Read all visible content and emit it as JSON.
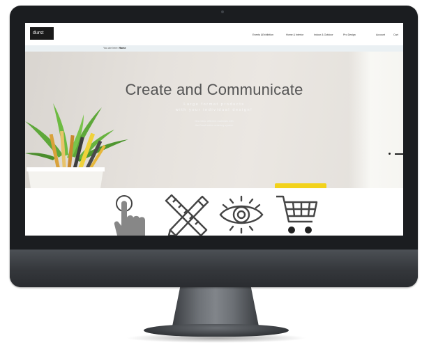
{
  "header": {
    "logo_text": "durst",
    "nav": [
      "Events &Exhibition",
      "Home & Interior",
      "Indoor & Outdoor",
      "Pro Design"
    ],
    "account": "Account",
    "cart": "Cart"
  },
  "breadcrumb": {
    "prefix": "You are here:",
    "current": "Home"
  },
  "hero": {
    "title": "Create and Communicate",
    "subtitle_line1": "Large format products",
    "subtitle_line2": "with your individual design!",
    "text_line1": "One idea, different materials with",
    "text_line2": "the Durst online ordering system"
  },
  "icons": [
    "touch-hand-icon",
    "ruler-pencil-icon",
    "eye-icon",
    "shopping-cart-icon"
  ],
  "colors": {
    "accent_yellow": "#f2d21b",
    "bezel": "#1b1d20",
    "breadcrumb_bg": "#eaf0f3"
  }
}
